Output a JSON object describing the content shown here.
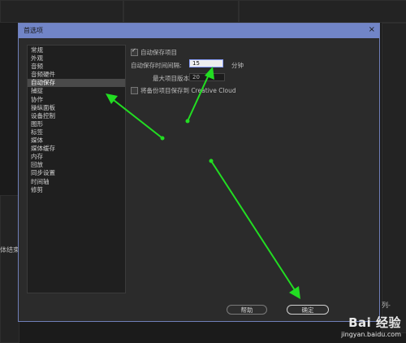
{
  "background": {
    "left_panel_text": "体结束",
    "right_panel_text": "列-"
  },
  "dialog": {
    "title": "首选项",
    "close_glyph": "×"
  },
  "categories": [
    {
      "label": "常规"
    },
    {
      "label": "外观"
    },
    {
      "label": "音频"
    },
    {
      "label": "音频硬件"
    },
    {
      "label": "自动保存"
    },
    {
      "label": "捕捉"
    },
    {
      "label": "协作"
    },
    {
      "label": "操纵面板"
    },
    {
      "label": "设备控制"
    },
    {
      "label": "图形"
    },
    {
      "label": "标签"
    },
    {
      "label": "媒体"
    },
    {
      "label": "媒体缓存"
    },
    {
      "label": "内存"
    },
    {
      "label": "回放"
    },
    {
      "label": "同步设置"
    },
    {
      "label": "时间轴"
    },
    {
      "label": "修剪"
    }
  ],
  "selected_category": "自动保存",
  "autosave": {
    "auto_save_label": "自动保存项目",
    "auto_save_checked": true,
    "interval_label": "自动保存时间间隔:",
    "interval_value": "15",
    "interval_unit": "分钟",
    "max_versions_label": "最大项目版本:",
    "max_versions_value": "20",
    "cloud_label": "将备份项目保存到 Creative Cloud",
    "cloud_checked": false
  },
  "buttons": {
    "help_label": "帮助",
    "ok_label": "确定"
  },
  "watermark": {
    "logo": "Bai 经验",
    "url": "jingyan.baidu.com"
  },
  "colors": {
    "title_bar": "#7185c7",
    "annotation_arrow": "#22dd22"
  }
}
